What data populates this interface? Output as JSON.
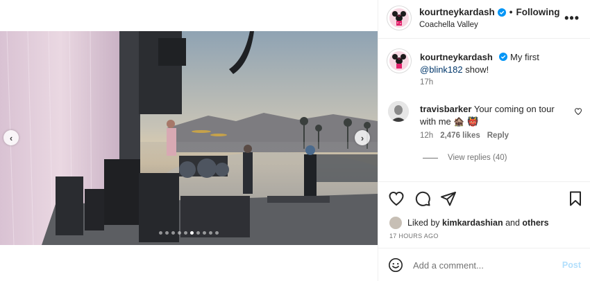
{
  "post": {
    "author": "kourtneykardash",
    "follow_status": "Following",
    "separator": "•",
    "location": "Coachella Valley",
    "more_label": "•••"
  },
  "caption": {
    "username": "kourtneykardash",
    "text": "My first",
    "mention": "@blink182",
    "text_after": "show!",
    "time": "17h"
  },
  "comment": {
    "username": "travisbarker",
    "text": "Your coming on tour with me 🏚️ 👹",
    "time": "12h",
    "likes": "2,476 likes",
    "reply_label": "Reply",
    "view_replies": "View replies (40)"
  },
  "likes": {
    "prefix": "Liked by",
    "user": "kimkardashian",
    "conjunction": "and",
    "others": "others"
  },
  "timestamp": "17 HOURS AGO",
  "add_comment": {
    "placeholder": "Add a comment...",
    "post_label": "Post"
  },
  "carousel": {
    "total_slides": 10,
    "active_index": 5,
    "prev_label": "‹",
    "next_label": "›"
  },
  "colors": {
    "verified": "#0095f6",
    "post_disabled": "#b2dffc",
    "mention": "#00376b",
    "meta_gray": "#737373"
  },
  "icons": {
    "like": "heart-icon",
    "comment": "comment-icon",
    "share": "share-icon",
    "save": "bookmark-icon",
    "emoji": "emoji-icon",
    "verified": "verified-badge-icon"
  }
}
